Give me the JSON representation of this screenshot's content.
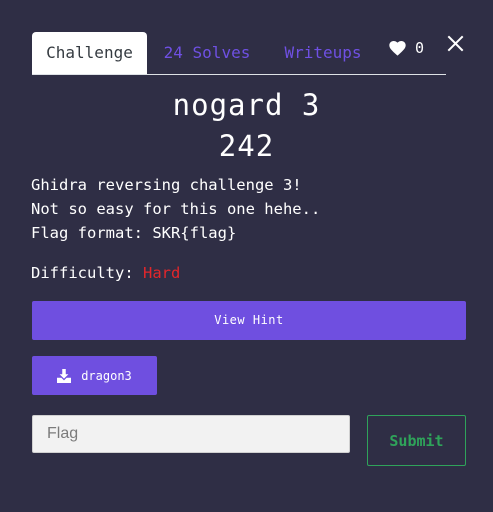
{
  "tabs": {
    "challenge": "Challenge",
    "solves": "24 Solves",
    "writeups": "Writeups"
  },
  "likes": {
    "count": "0",
    "icon": "heart-icon"
  },
  "close": {
    "icon": "close-icon"
  },
  "challenge": {
    "name": "nogard 3",
    "value": "242",
    "description": "Ghidra reversing challenge 3!\nNot so easy for this one hehe..\nFlag format: SKR{flag}",
    "difficulty_label": "Difficulty:",
    "difficulty_value": "Hard"
  },
  "hint": {
    "label": "View Hint"
  },
  "file": {
    "name": "dragon3",
    "icon": "download-icon"
  },
  "submission": {
    "placeholder": "Flag",
    "value": "",
    "submit_label": "Submit"
  },
  "colors": {
    "background": "#2f2e45",
    "accent": "#6f4fe0",
    "hard": "#e3262b",
    "submit": "#2fa35a"
  }
}
